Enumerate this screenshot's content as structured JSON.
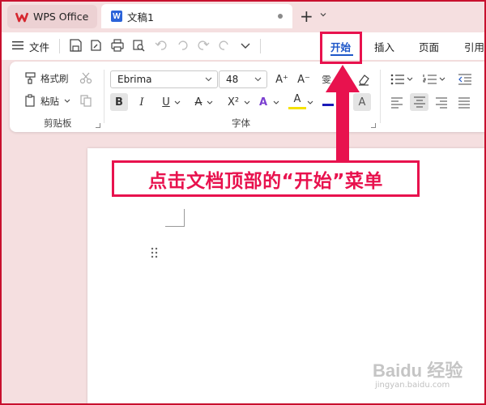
{
  "tabs": {
    "home_label": "WPS Office",
    "doc_label": "文稿1",
    "doc_icon_letter": "W"
  },
  "menu": {
    "file_label": "文件",
    "items": [
      "开始",
      "插入",
      "页面",
      "引用"
    ],
    "active_index": 0
  },
  "ribbon": {
    "clipboard": {
      "format_painter": "格式刷",
      "paste": "粘贴",
      "group_label": "剪贴板"
    },
    "font": {
      "font_name": "Ebrima",
      "font_size": "48",
      "group_label": "字体",
      "grow_label": "A⁺",
      "shrink_label": "A⁻",
      "bold": "B",
      "italic": "I",
      "underline": "U",
      "strike": "A",
      "superscript": "X²",
      "font_color": "A",
      "highlight": "A",
      "char_shading": "A"
    }
  },
  "annotation": {
    "text": "点击文档顶部的“开始”菜单",
    "color": "#e8124e"
  },
  "watermark": {
    "text": "Baidu 经验",
    "sub": "jingyan.baidu.com"
  },
  "colors": {
    "accent": "#1d56c8",
    "titlebar": "#f5dfe0",
    "annotation": "#e8124e"
  }
}
